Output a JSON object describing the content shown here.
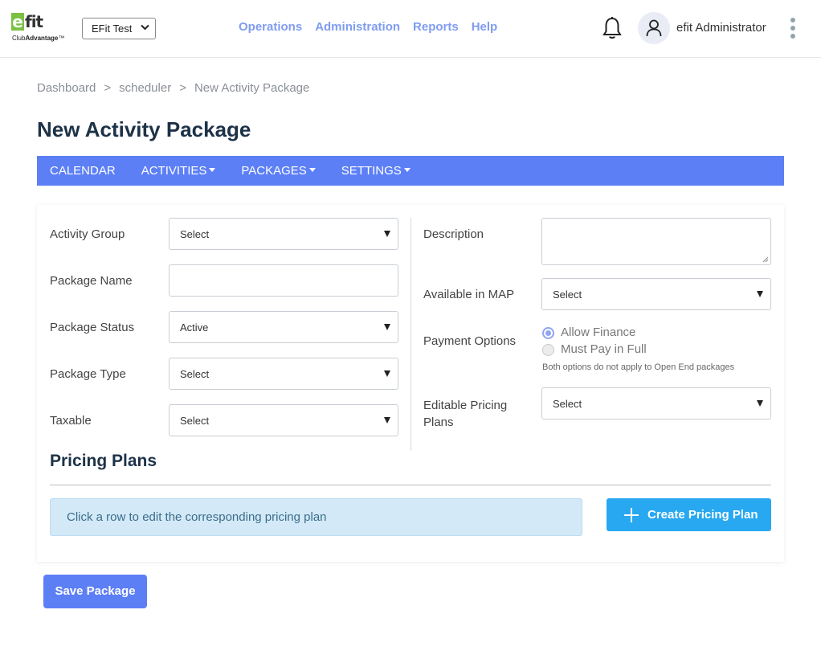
{
  "header": {
    "logo_text": "efit",
    "logo_sub_prefix": "Club",
    "logo_sub_brand": "Advantage",
    "logo_tm": "™",
    "club_select_value": "EFit Test",
    "nav": [
      "Operations",
      "Administration",
      "Reports",
      "Help"
    ],
    "user_name": "efit Administrator"
  },
  "breadcrumb": [
    "Dashboard",
    "scheduler",
    "New Activity Package"
  ],
  "breadcrumb_sep": ">",
  "page_title": "New Activity Package",
  "subnav": {
    "calendar": "CALENDAR",
    "activities": "ACTIVITIES",
    "packages": "PACKAGES",
    "settings": "SETTINGS"
  },
  "form": {
    "activity_group": {
      "label": "Activity Group",
      "value": "Select"
    },
    "package_name": {
      "label": "Package Name",
      "value": ""
    },
    "package_status": {
      "label": "Package Status",
      "value": "Active"
    },
    "package_type": {
      "label": "Package Type",
      "value": "Select"
    },
    "taxable": {
      "label": "Taxable",
      "value": "Select"
    },
    "description": {
      "label": "Description",
      "value": ""
    },
    "available_in_map": {
      "label": "Available in MAP",
      "value": "Select"
    },
    "payment_options": {
      "label": "Payment Options",
      "options": [
        "Allow Finance",
        "Must Pay in Full"
      ],
      "selected": "Allow Finance",
      "hint": "Both options do not apply to Open End packages"
    },
    "editable_pricing_plans": {
      "label_line1": "Editable Pricing",
      "label_line2": "Plans",
      "value": "Select"
    }
  },
  "pricing": {
    "title": "Pricing Plans",
    "info": "Click a row to edit the corresponding pricing plan",
    "create_label": "Create Pricing Plan"
  },
  "save_label": "Save Package",
  "colors": {
    "primary": "#5c7ff6",
    "nav_link": "#7f9cf0",
    "info_bg": "#d3e9f8",
    "create_btn": "#27a8f1",
    "title": "#1d3247",
    "logo_green": "#7ac143"
  }
}
